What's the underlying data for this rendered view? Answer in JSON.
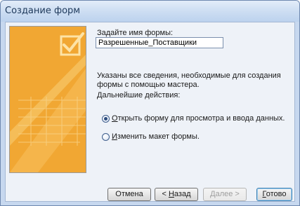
{
  "window": {
    "title": "Создание форм"
  },
  "form": {
    "name_label": "Задайте имя формы:",
    "name_value": "Разрешенные_Поставщики"
  },
  "info": {
    "text": "Указаны все сведения, необходимые для создания формы с помощью мастера.",
    "next_actions_label": "Дальнейшие действия:"
  },
  "options": [
    {
      "prefix": "",
      "accel": "О",
      "rest": "ткрыть форму для просмотра и ввода данных.",
      "checked": true
    },
    {
      "prefix": "",
      "accel": "И",
      "rest": "зменить макет формы.",
      "checked": false
    }
  ],
  "buttons": {
    "cancel": "Отмена",
    "back_prefix": "< ",
    "back_accel": "Н",
    "back_rest": "азад",
    "next": "Далее >",
    "finish_accel": "Г",
    "finish_rest": "отово"
  },
  "colors": {
    "wizard_orange": "#f1a733",
    "wizard_light": "#f8cb72",
    "window_frame": "#c7d8ef"
  },
  "icons": {
    "wizard_graphic": "form-checkmark-illustration"
  }
}
